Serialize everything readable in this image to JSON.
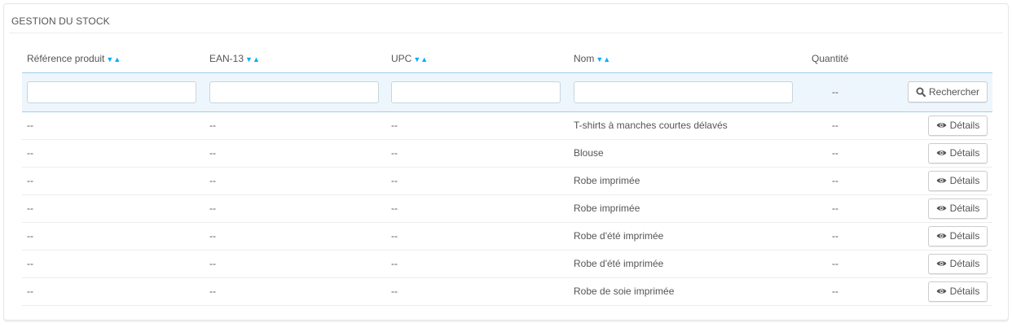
{
  "panel": {
    "title": "Gestion du stock"
  },
  "columns": {
    "reference": "Référence produit",
    "ean13": "EAN-13",
    "upc": "UPC",
    "name": "Nom",
    "quantity": "Quantité"
  },
  "sort_icons": {
    "desc": "▼",
    "asc": "▲"
  },
  "filter": {
    "reference_value": "",
    "ean13_value": "",
    "upc_value": "",
    "name_value": "",
    "quantity_text": "--",
    "search_label": "Rechercher"
  },
  "rows": [
    {
      "reference": "--",
      "ean13": "--",
      "upc": "--",
      "name": "T-shirts à manches courtes délavés",
      "quantity": "--",
      "details_label": "Détails"
    },
    {
      "reference": "--",
      "ean13": "--",
      "upc": "--",
      "name": "Blouse",
      "quantity": "--",
      "details_label": "Détails"
    },
    {
      "reference": "--",
      "ean13": "--",
      "upc": "--",
      "name": "Robe imprimée",
      "quantity": "--",
      "details_label": "Détails"
    },
    {
      "reference": "--",
      "ean13": "--",
      "upc": "--",
      "name": "Robe imprimée",
      "quantity": "--",
      "details_label": "Détails"
    },
    {
      "reference": "--",
      "ean13": "--",
      "upc": "--",
      "name": "Robe d'été imprimée",
      "quantity": "--",
      "details_label": "Détails"
    },
    {
      "reference": "--",
      "ean13": "--",
      "upc": "--",
      "name": "Robe d'été imprimée",
      "quantity": "--",
      "details_label": "Détails"
    },
    {
      "reference": "--",
      "ean13": "--",
      "upc": "--",
      "name": "Robe de soie imprimée",
      "quantity": "--",
      "details_label": "Détails"
    }
  ],
  "colors": {
    "accent": "#00aff0",
    "filter_bg": "#eef6fd"
  }
}
